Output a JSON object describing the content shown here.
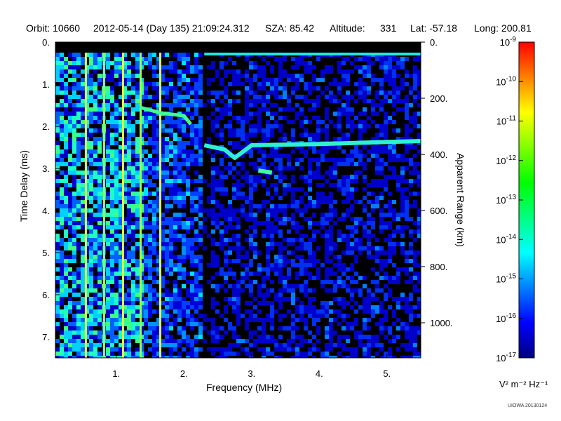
{
  "header": {
    "orbit": "Orbit: 10660",
    "datetime": "2012-05-14 (Day 135) 21:09:24.312",
    "sza": "SZA:  85.42",
    "altitude": "Altitude:",
    "altitude_value": "331",
    "lat": "Lat: -57.18",
    "long": "Long: 200.81"
  },
  "watermark": "UIOWA 20130124",
  "chart_data": {
    "type": "heatmap",
    "title": "",
    "xlabel": "Frequency (MHz)",
    "ylabel": "Time Delay (ms)",
    "y2label": "Apparent Range (km)",
    "xlim": [
      0.1,
      5.5
    ],
    "ylim": [
      0,
      7.5
    ],
    "y2lim": [
      0,
      1125
    ],
    "y_inverted": true,
    "x_ticks": [
      1,
      2,
      3,
      4,
      5
    ],
    "x_tick_labels": [
      "1.",
      "2.",
      "3.",
      "4.",
      "5."
    ],
    "y_ticks": [
      0,
      1,
      2,
      3,
      4,
      5,
      6,
      7
    ],
    "y_tick_labels": [
      "0.",
      "1.",
      "2.",
      "3.",
      "4.",
      "5.",
      "6.",
      "7."
    ],
    "y2_ticks": [
      0,
      200,
      400,
      600,
      800,
      1000
    ],
    "y2_tick_labels": [
      "0.",
      "200.",
      "400.",
      "600.",
      "800.",
      "1000."
    ],
    "colorbar": {
      "scale": "log",
      "min": 1e-17,
      "max": 1e-09,
      "tick_exponents": [
        -9,
        -10,
        -11,
        -12,
        -13,
        -14,
        -15,
        -16,
        -17
      ],
      "tick_base": "10",
      "units": "V² m⁻² Hz⁻¹",
      "colors": [
        "#000080",
        "#0000ff",
        "#0080ff",
        "#00ffff",
        "#00ff80",
        "#00ff00",
        "#80ff00",
        "#ffff00",
        "#ff8000",
        "#ff0000"
      ]
    },
    "features": {
      "surface_echo_trace": [
        {
          "f": 1.35,
          "t": 1.55
        },
        {
          "f": 1.65,
          "t": 1.68
        },
        {
          "f": 2.0,
          "t": 1.75
        },
        {
          "f": 2.1,
          "t": 1.95
        }
      ],
      "ionospheric_trace": [
        {
          "f": 2.3,
          "t": 2.45
        },
        {
          "f": 2.6,
          "t": 2.55
        },
        {
          "f": 2.75,
          "t": 2.75
        },
        {
          "f": 3.0,
          "t": 2.45
        },
        {
          "f": 4.0,
          "t": 2.42
        },
        {
          "f": 5.5,
          "t": 2.35
        }
      ],
      "secondary_trace": [
        {
          "f": 3.1,
          "t": 3.05
        },
        {
          "f": 3.3,
          "t": 3.1
        }
      ],
      "harmonic_lines_mhz": [
        0.55,
        0.82,
        1.1,
        1.36,
        1.65
      ],
      "top_band_delay_ms": 0.25,
      "black_gap_delay_ms": [
        0,
        0.25
      ]
    }
  }
}
